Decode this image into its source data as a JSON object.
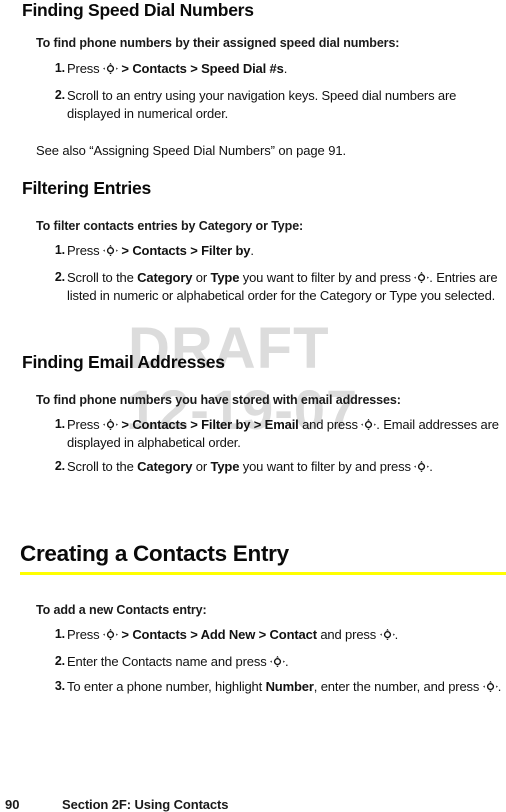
{
  "document": {
    "watermark": {
      "line1": "DRAFT",
      "line2": "12-19-07",
      "color": "#dcdcdc"
    },
    "accent_rule_color": "#ffff00",
    "icon_names": {
      "navigation_key": "navigation-key-icon"
    }
  },
  "sections": [
    {
      "id": "finding-speed-dial-numbers",
      "heading": "Finding Speed Dial Numbers",
      "lead": "To find phone numbers by their assigned speed dial numbers:",
      "steps": [
        {
          "number": "1.",
          "parts": [
            {
              "type": "text",
              "value": "Press "
            },
            {
              "type": "icon",
              "value": "navigation-key-icon"
            },
            {
              "type": "bold",
              "value": " > Contacts > Speed Dial #s"
            },
            {
              "type": "text",
              "value": "."
            }
          ]
        },
        {
          "number": "2.",
          "parts": [
            {
              "type": "text",
              "value": "Scroll to an entry using your navigation keys. Speed dial numbers are displayed in numerical order."
            }
          ]
        }
      ],
      "note": "See also “Assigning Speed Dial Numbers” on page 91."
    },
    {
      "id": "filtering-entries",
      "heading": "Filtering Entries",
      "lead": "To filter contacts entries by Category or Type:",
      "steps": [
        {
          "number": "1.",
          "parts": [
            {
              "type": "text",
              "value": "Press "
            },
            {
              "type": "icon",
              "value": "navigation-key-icon"
            },
            {
              "type": "bold",
              "value": " > Contacts > Filter by"
            },
            {
              "type": "text",
              "value": "."
            }
          ]
        },
        {
          "number": "2.",
          "parts": [
            {
              "type": "text",
              "value": "Scroll to the "
            },
            {
              "type": "bold",
              "value": "Category"
            },
            {
              "type": "text",
              "value": " or "
            },
            {
              "type": "bold",
              "value": "Type"
            },
            {
              "type": "text",
              "value": " you want to filter by and press "
            },
            {
              "type": "icon",
              "value": "navigation-key-icon"
            },
            {
              "type": "text",
              "value": ". Entries are listed in numeric or alphabetical order for the Category or Type you selected."
            }
          ]
        }
      ],
      "note": ""
    },
    {
      "id": "finding-email-addresses",
      "heading": "Finding Email Addresses",
      "lead": "To find phone numbers you have stored with email addresses:",
      "steps": [
        {
          "number": "1.",
          "parts": [
            {
              "type": "text",
              "value": "Press "
            },
            {
              "type": "icon",
              "value": "navigation-key-icon"
            },
            {
              "type": "bold",
              "value": " > Contacts > Filter by > Email"
            },
            {
              "type": "text",
              "value": " and press "
            },
            {
              "type": "icon",
              "value": "navigation-key-icon"
            },
            {
              "type": "text",
              "value": ". Email addresses are displayed in alphabetical order."
            }
          ]
        },
        {
          "number": "2.",
          "parts": [
            {
              "type": "text",
              "value": "Scroll to the "
            },
            {
              "type": "bold",
              "value": "Category"
            },
            {
              "type": "text",
              "value": " or "
            },
            {
              "type": "bold",
              "value": "Type"
            },
            {
              "type": "text",
              "value": " you want to filter by and press "
            },
            {
              "type": "icon",
              "value": "navigation-key-icon"
            },
            {
              "type": "text",
              "value": "."
            }
          ]
        }
      ],
      "note": ""
    }
  ],
  "chapter": {
    "id": "creating-a-contacts-entry",
    "heading": "Creating a Contacts Entry",
    "lead": "To add a new Contacts entry:",
    "steps": [
      {
        "number": "1.",
        "parts": [
          {
            "type": "text",
            "value": "Press "
          },
          {
            "type": "icon",
            "value": "navigation-key-icon"
          },
          {
            "type": "bold",
            "value": " > Contacts > Add New > Contact"
          },
          {
            "type": "text",
            "value": " and press "
          },
          {
            "type": "icon",
            "value": "navigation-key-icon"
          },
          {
            "type": "text",
            "value": "."
          }
        ]
      },
      {
        "number": "2.",
        "parts": [
          {
            "type": "text",
            "value": "Enter the Contacts name and press "
          },
          {
            "type": "icon",
            "value": "navigation-key-icon"
          },
          {
            "type": "text",
            "value": "."
          }
        ]
      },
      {
        "number": "3.",
        "parts": [
          {
            "type": "text",
            "value": "To enter a phone number, highlight "
          },
          {
            "type": "bold",
            "value": "Number"
          },
          {
            "type": "text",
            "value": ", enter the number, and press "
          },
          {
            "type": "icon",
            "value": "navigation-key-icon"
          },
          {
            "type": "text",
            "value": "."
          }
        ]
      }
    ]
  },
  "footer": {
    "page_number": "90",
    "section_label": "Section 2F: Using Contacts"
  }
}
